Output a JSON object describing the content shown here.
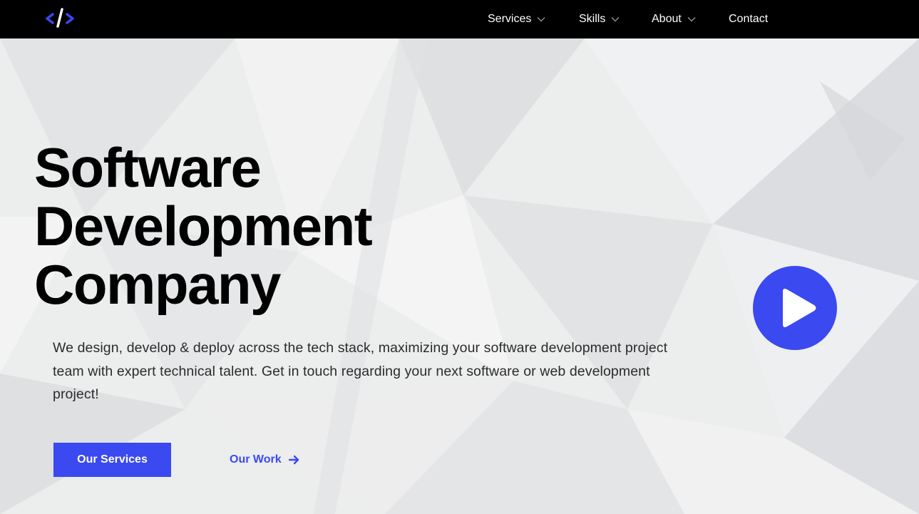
{
  "nav": {
    "logo_icon": "code-slash-icon",
    "items": [
      {
        "label": "Services",
        "has_dropdown": true
      },
      {
        "label": "Skills",
        "has_dropdown": true
      },
      {
        "label": "About",
        "has_dropdown": true
      },
      {
        "label": "Contact",
        "has_dropdown": false
      }
    ]
  },
  "hero": {
    "headline_lines": [
      "Software",
      "Development",
      "Company"
    ],
    "description": "We design, develop & deploy across the tech stack, maximizing your software development project team with expert technical talent. Get in touch regarding your next software or web development project!",
    "primary_button": "Our Services",
    "secondary_link": "Our Work",
    "play_icon": "play-icon"
  },
  "colors": {
    "accent": "#3a49f0",
    "navbar_bg": "#000000",
    "hero_bg": "#ebecee",
    "text": "#000000"
  }
}
